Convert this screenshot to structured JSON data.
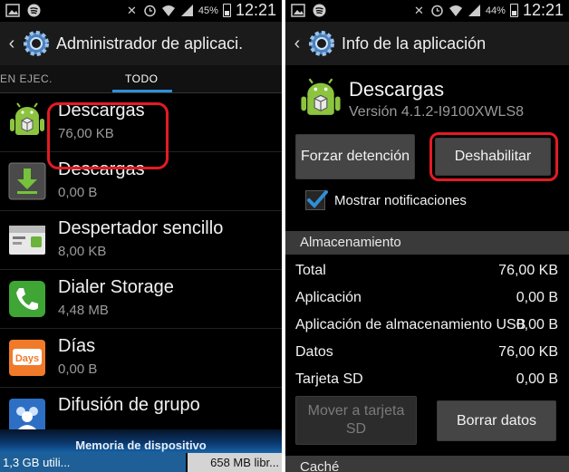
{
  "status_left": {
    "time": "12:21",
    "battery": "45%"
  },
  "status_right": {
    "time": "12:21",
    "battery": "44%"
  },
  "left": {
    "title": "Administrador de aplicaci.",
    "tabs": [
      "EN EJEC.",
      "TODO"
    ],
    "active_tab": "TODO",
    "apps": [
      {
        "name": "Descargas",
        "size": "76,00 KB",
        "icon": "android-box-icon",
        "highlighted": true
      },
      {
        "name": "Descargas",
        "size": "0,00 B",
        "icon": "download-arrow-icon"
      },
      {
        "name": "Despertador sencillo",
        "size": "8,00 KB",
        "icon": "alarm-widget-icon"
      },
      {
        "name": "Dialer Storage",
        "size": "4,48 MB",
        "icon": "phone-icon"
      },
      {
        "name": "Días",
        "size": "0,00 B",
        "icon": "days-icon"
      },
      {
        "name": "Difusión de grupo",
        "size": "",
        "icon": "group-icon"
      }
    ],
    "storage": {
      "label": "Memoria de dispositivo",
      "used": "1,3 GB utili...",
      "free": "658 MB libr..."
    }
  },
  "right": {
    "title": "Info de la aplicación",
    "app_name": "Descargas",
    "version": "Versión 4.1.2-I9100XWLS8",
    "force_stop": "Forzar detención",
    "disable": "Deshabilitar",
    "show_notifications": "Mostrar notificaciones",
    "notifications_checked": true,
    "storage_header": "Almacenamiento",
    "storage_rows": [
      {
        "label": "Total",
        "value": "76,00 KB"
      },
      {
        "label": "Aplicación",
        "value": "0,00 B"
      },
      {
        "label": "Aplicación de almacenamiento USB",
        "value": "0,00 B"
      },
      {
        "label": "Datos",
        "value": "76,00 KB"
      },
      {
        "label": "Tarjeta SD",
        "value": "0,00 B"
      }
    ],
    "move_sd": "Mover a tarjeta SD",
    "clear_data": "Borrar datos",
    "cache_header": "Caché"
  },
  "colors": {
    "highlight": "#e31b23",
    "tab_indicator": "#2f8fd6",
    "storage_used": "#1e5f97"
  }
}
